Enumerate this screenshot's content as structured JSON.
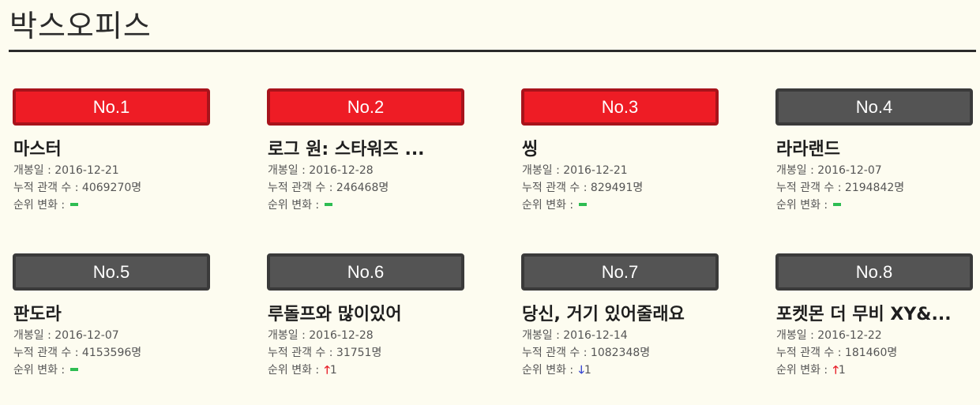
{
  "page": {
    "title": "박스오피스"
  },
  "labels": {
    "open_date": "개봉일 : ",
    "audience": "누적 관객 수 : ",
    "rank_change": "순위 변화 : ",
    "audience_unit": "명"
  },
  "colors": {
    "top_badge": "#ee1c25",
    "normal_badge": "#545454",
    "no_change": "#2ebd52",
    "up": "#e8202a",
    "down": "#3a49d3"
  },
  "movies": [
    {
      "rank": "No.1",
      "title": "마스터",
      "open_date": "2016-12-21",
      "audience": "4069270",
      "change": "none",
      "change_value": "",
      "change_icon": "no-change-icon"
    },
    {
      "rank": "No.2",
      "title": "로그 원: 스타워즈 ...",
      "open_date": "2016-12-28",
      "audience": "246468",
      "change": "none",
      "change_value": "",
      "change_icon": "no-change-icon"
    },
    {
      "rank": "No.3",
      "title": "씽",
      "open_date": "2016-12-21",
      "audience": "829491",
      "change": "none",
      "change_value": "",
      "change_icon": "no-change-icon"
    },
    {
      "rank": "No.4",
      "title": "라라랜드",
      "open_date": "2016-12-07",
      "audience": "2194842",
      "change": "none",
      "change_value": "",
      "change_icon": "no-change-icon"
    },
    {
      "rank": "No.5",
      "title": "판도라",
      "open_date": "2016-12-07",
      "audience": "4153596",
      "change": "none",
      "change_value": "",
      "change_icon": "no-change-icon"
    },
    {
      "rank": "No.6",
      "title": "루돌프와 많이있어",
      "open_date": "2016-12-28",
      "audience": "31751",
      "change": "up",
      "change_value": "1",
      "change_icon": "arrow-up-icon"
    },
    {
      "rank": "No.7",
      "title": "당신, 거기 있어줄래요",
      "open_date": "2016-12-14",
      "audience": "1082348",
      "change": "down",
      "change_value": "1",
      "change_icon": "arrow-down-icon"
    },
    {
      "rank": "No.8",
      "title": "포켓몬 더 무비 XY&...",
      "open_date": "2016-12-22",
      "audience": "181460",
      "change": "up",
      "change_value": "1",
      "change_icon": "arrow-up-icon"
    }
  ]
}
